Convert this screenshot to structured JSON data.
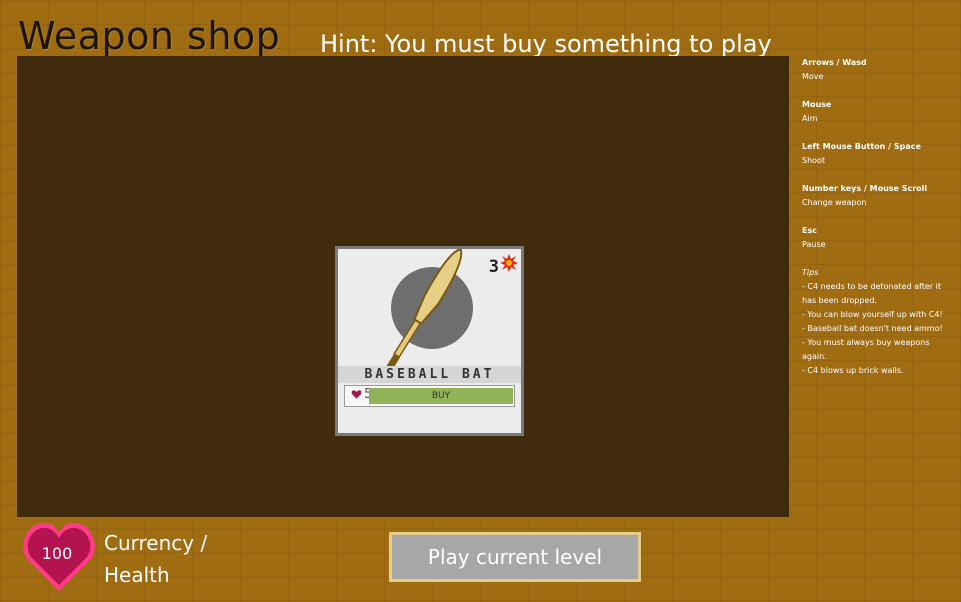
{
  "header": {
    "title": "Weapon shop",
    "hint": "Hint: You must buy something to play"
  },
  "shop": {
    "items": [
      {
        "name": "BASEBALL BAT",
        "damage": "3",
        "damage_icon": "explosion-icon",
        "price": "5",
        "price_icon": "heart-icon",
        "buy_label": "BUY",
        "icon": "baseball-bat-icon"
      }
    ]
  },
  "controls": [
    {
      "key": "Arrows / Wasd",
      "action": "Move"
    },
    {
      "key": "Mouse",
      "action": "Aim"
    },
    {
      "key": "Left Mouse Button / Space",
      "action": "Shoot"
    },
    {
      "key": "Number keys /  Mouse Scroll",
      "action": "Change weapon"
    },
    {
      "key": "Esc",
      "action": "Pause"
    }
  ],
  "tips": {
    "title": "Tips",
    "items": [
      "- C4 needs to be detonated after it has been dropped.",
      "- You can blow yourself up with C4!",
      "- Baseball bat doesn't need ammo!",
      "- You must always buy weapons again.",
      "- C4 blows up brick walls."
    ]
  },
  "footer": {
    "currency_value": "100",
    "currency_label": "Currency /",
    "health_label": "Health",
    "play_button": "Play current level"
  },
  "colors": {
    "background": "#a06c12",
    "shop_area": "#3f2a0b",
    "heart": "#b3134e",
    "buy_button": "#8fb357",
    "play_button": "#a7a7a7",
    "play_button_border": "#e5cd8a"
  }
}
